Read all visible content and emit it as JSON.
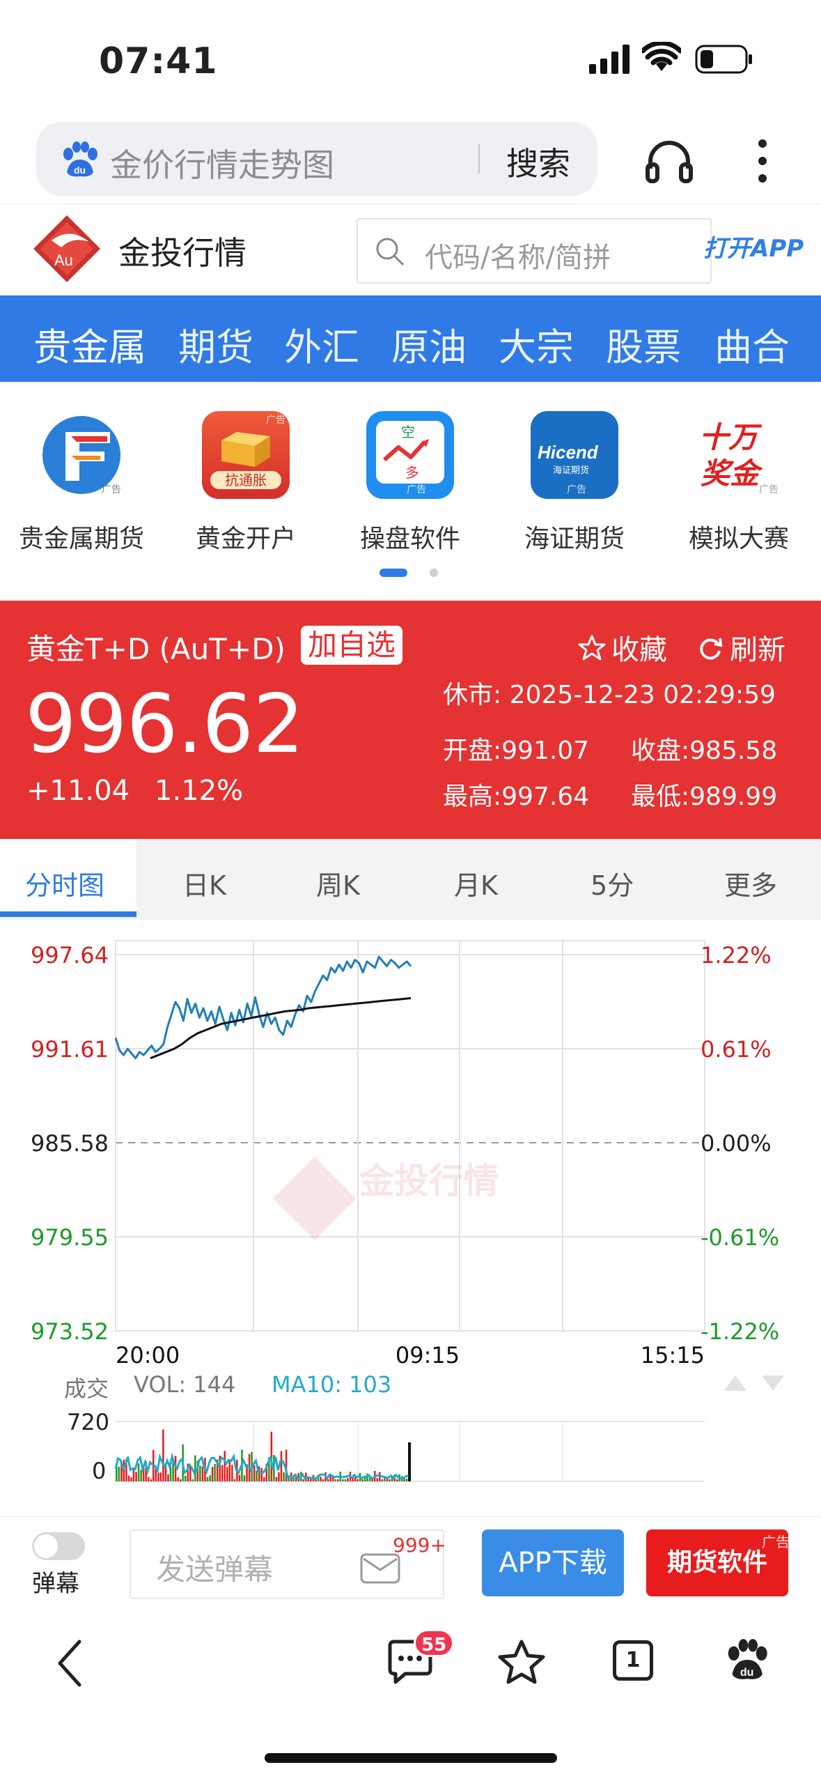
{
  "status_bar": {
    "time": "07:41"
  },
  "browser": {
    "search_text": "金价行情走势图",
    "search_button": "搜索"
  },
  "site": {
    "name": "金投行情",
    "search_placeholder": "代码/名称/简拼",
    "open_app": "打开APP"
  },
  "nav": [
    "贵金属",
    "期货",
    "外汇",
    "原油",
    "大宗",
    "股票",
    "曲合"
  ],
  "apps": [
    {
      "label": "贵金属期货",
      "ad": "广告",
      "icon": "gf-logo-icon"
    },
    {
      "label": "黄金开户",
      "ad": "广告",
      "sub": "抗通胀",
      "icon": "gold-bar-icon"
    },
    {
      "label": "操盘软件",
      "ad": "广告",
      "icon": "trading-chart-icon",
      "top": "空",
      "bottom": "多"
    },
    {
      "label": "海证期货",
      "ad": "广告",
      "icon": "hicend-logo-icon",
      "brand": "Hicend",
      "sub": "海证期货"
    },
    {
      "label": "模拟大赛",
      "ad": "广告",
      "icon": "prize-icon",
      "l1": "十万",
      "l2": "奖金"
    }
  ],
  "quote": {
    "name": "黄金T+D (AuT+D)",
    "add": "加自选",
    "fav": "收藏",
    "refresh": "刷新",
    "price": "996.62",
    "change": "+11.04",
    "change_pct": "1.12%",
    "closed": "休市:  2025-12-23 02:29:59",
    "open": "开盘:991.07",
    "prev_close": "收盘:985.58",
    "high": "最高:997.64",
    "low": "最低:989.99"
  },
  "tabs": [
    "分时图",
    "日K",
    "周K",
    "月K",
    "5分",
    "更多"
  ],
  "chart_data": {
    "type": "line",
    "left_ticks": [
      "997.64",
      "991.61",
      "985.58",
      "979.55",
      "973.52"
    ],
    "right_ticks": [
      "1.22%",
      "0.61%",
      "0.00%",
      "-0.61%",
      "-1.22%"
    ],
    "x_ticks": [
      "20:00",
      "09:15",
      "15:15"
    ],
    "ylim": [
      973.52,
      997.64
    ],
    "baseline": 985.58,
    "watermark": "金投行情",
    "series": [
      {
        "name": "price",
        "color": "#1f7fb8",
        "values": [
          992.3,
          991.5,
          991.2,
          991.6,
          991.3,
          991.0,
          991.4,
          991.2,
          991.5,
          991.8,
          991.4,
          991.6,
          991.9,
          993.0,
          993.8,
          994.6,
          994.2,
          993.4,
          994.8,
          993.9,
          994.5,
          993.6,
          994.2,
          993.4,
          994.0,
          993.2,
          994.3,
          993.5,
          992.8,
          993.9,
          993.1,
          994.1,
          993.3,
          994.5,
          993.7,
          994.9,
          993.8,
          993.0,
          993.9,
          993.2,
          993.6,
          992.8,
          992.5,
          993.4,
          993.0,
          993.8,
          994.4,
          994.0,
          995.0,
          994.6,
          995.3,
          995.8,
          996.3,
          996.0,
          996.8,
          996.5,
          997.0,
          996.6,
          997.2,
          996.8,
          997.3,
          997.1,
          996.5,
          997.2,
          997.0,
          996.8,
          997.5,
          997.2,
          996.9,
          997.3,
          997.1,
          996.8,
          997.0,
          997.2,
          996.9
        ]
      },
      {
        "name": "avg",
        "color": "#111111",
        "values": [
          991.0,
          991.2,
          991.4,
          991.6,
          991.9,
          992.3,
          992.6,
          992.8,
          993.0,
          993.2,
          993.3,
          993.4,
          993.5,
          993.6,
          993.7,
          993.8,
          993.9,
          994.0,
          994.05,
          994.1,
          994.2,
          994.25,
          994.3,
          994.35,
          994.4,
          994.45,
          994.5,
          994.55,
          994.6,
          994.65,
          994.7,
          994.75,
          994.8,
          994.85
        ]
      }
    ],
    "volume": {
      "label": "成交",
      "vol_text": "VOL: 144",
      "ma_text": "MA10: 103",
      "ticks": [
        "720",
        "0"
      ],
      "max": 720
    }
  },
  "bottom": {
    "danmu_label": "弹幕",
    "danmu_placeholder": "发送弹幕",
    "badge": "999+",
    "app_download": "APP下载",
    "futures_soft": "期货软件",
    "ad": "广告"
  },
  "tabbar": {
    "comments_badge": "55",
    "tabs_count": "1"
  }
}
